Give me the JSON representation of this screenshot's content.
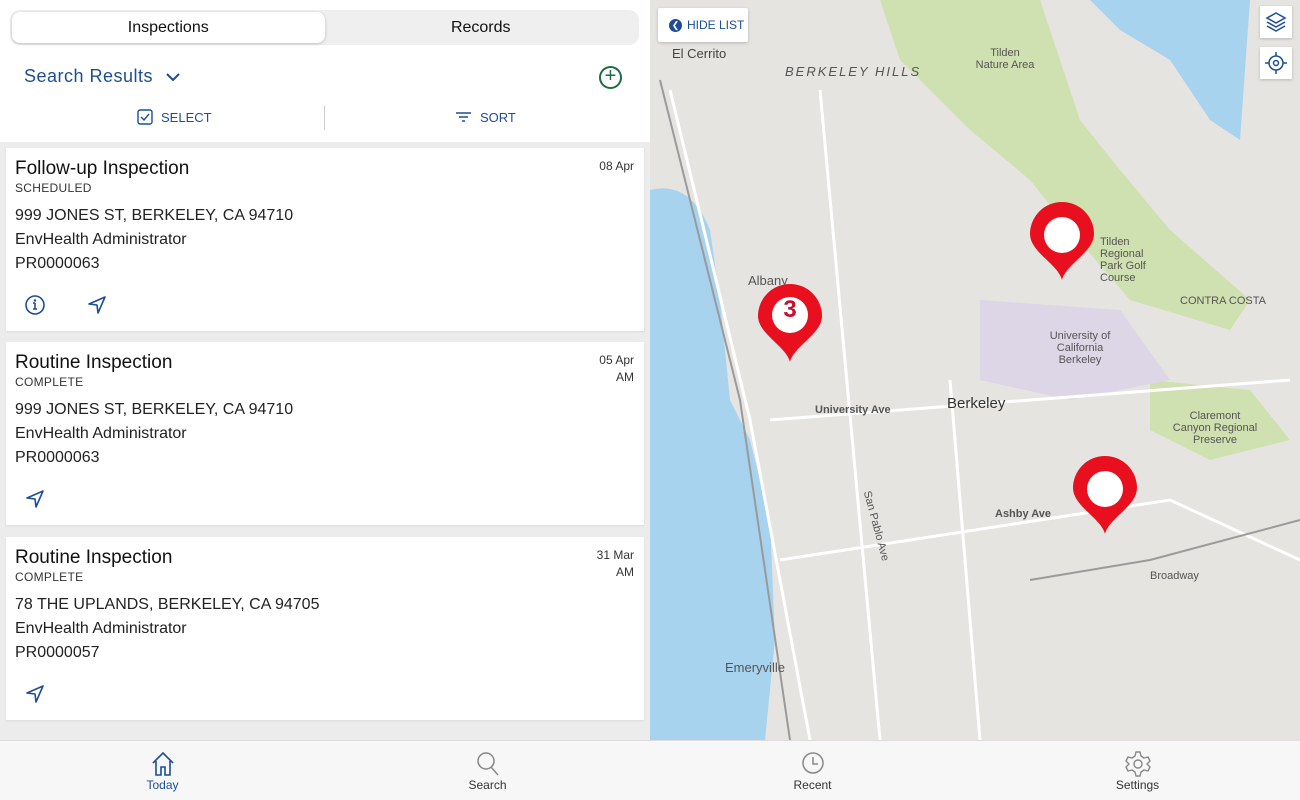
{
  "tabs": [
    {
      "label": "Inspections",
      "active": true
    },
    {
      "label": "Records",
      "active": false
    }
  ],
  "list_header": {
    "title": "Search Results",
    "select_label": "SELECT",
    "sort_label": "SORT"
  },
  "inspections": [
    {
      "title": "Follow-up Inspection",
      "status": "SCHEDULED",
      "date": "08 Apr",
      "time": "",
      "address": "999 JONES ST, BERKELEY, CA 94710",
      "inspector": "EnvHealth Administrator",
      "record": "PR0000063",
      "actions": [
        "info-icon",
        "navigate-icon"
      ]
    },
    {
      "title": "Routine Inspection",
      "status": "COMPLETE",
      "date": "05 Apr",
      "time": "AM",
      "address": "999 JONES ST, BERKELEY, CA 94710",
      "inspector": "EnvHealth Administrator",
      "record": "PR0000063",
      "actions": [
        "navigate-icon"
      ]
    },
    {
      "title": "Routine Inspection",
      "status": "COMPLETE",
      "date": "31 Mar",
      "time": "AM",
      "address": "78 THE UPLANDS, BERKELEY, CA 94705",
      "inspector": "EnvHealth Administrator",
      "record": "PR0000057",
      "actions": [
        "navigate-icon"
      ]
    }
  ],
  "map": {
    "hide_list_label": "HIDE LIST",
    "cluster_count": "3",
    "labels": [
      "El Cerrito",
      "BERKELEY HILLS",
      "Tilden Nature Area",
      "Albany",
      "Berkeley",
      "University Ave",
      "Ashby Ave",
      "Emeryville",
      "Claremont Canyon Regional Preserve",
      "Tilden Regional Park Golf Course",
      "University of California Berkeley",
      "CONTRA COSTA",
      "Broadway",
      "San Pablo Ave"
    ],
    "pin_color": "#e8101e"
  },
  "nav": [
    {
      "label": "Today",
      "icon": "home-icon",
      "active": true
    },
    {
      "label": "Search",
      "icon": "search-icon"
    },
    {
      "label": "Recent",
      "icon": "clock-icon"
    },
    {
      "label": "Settings",
      "icon": "gear-icon"
    }
  ],
  "colors": {
    "accent": "#1d4e95",
    "add": "#1f6b45"
  }
}
